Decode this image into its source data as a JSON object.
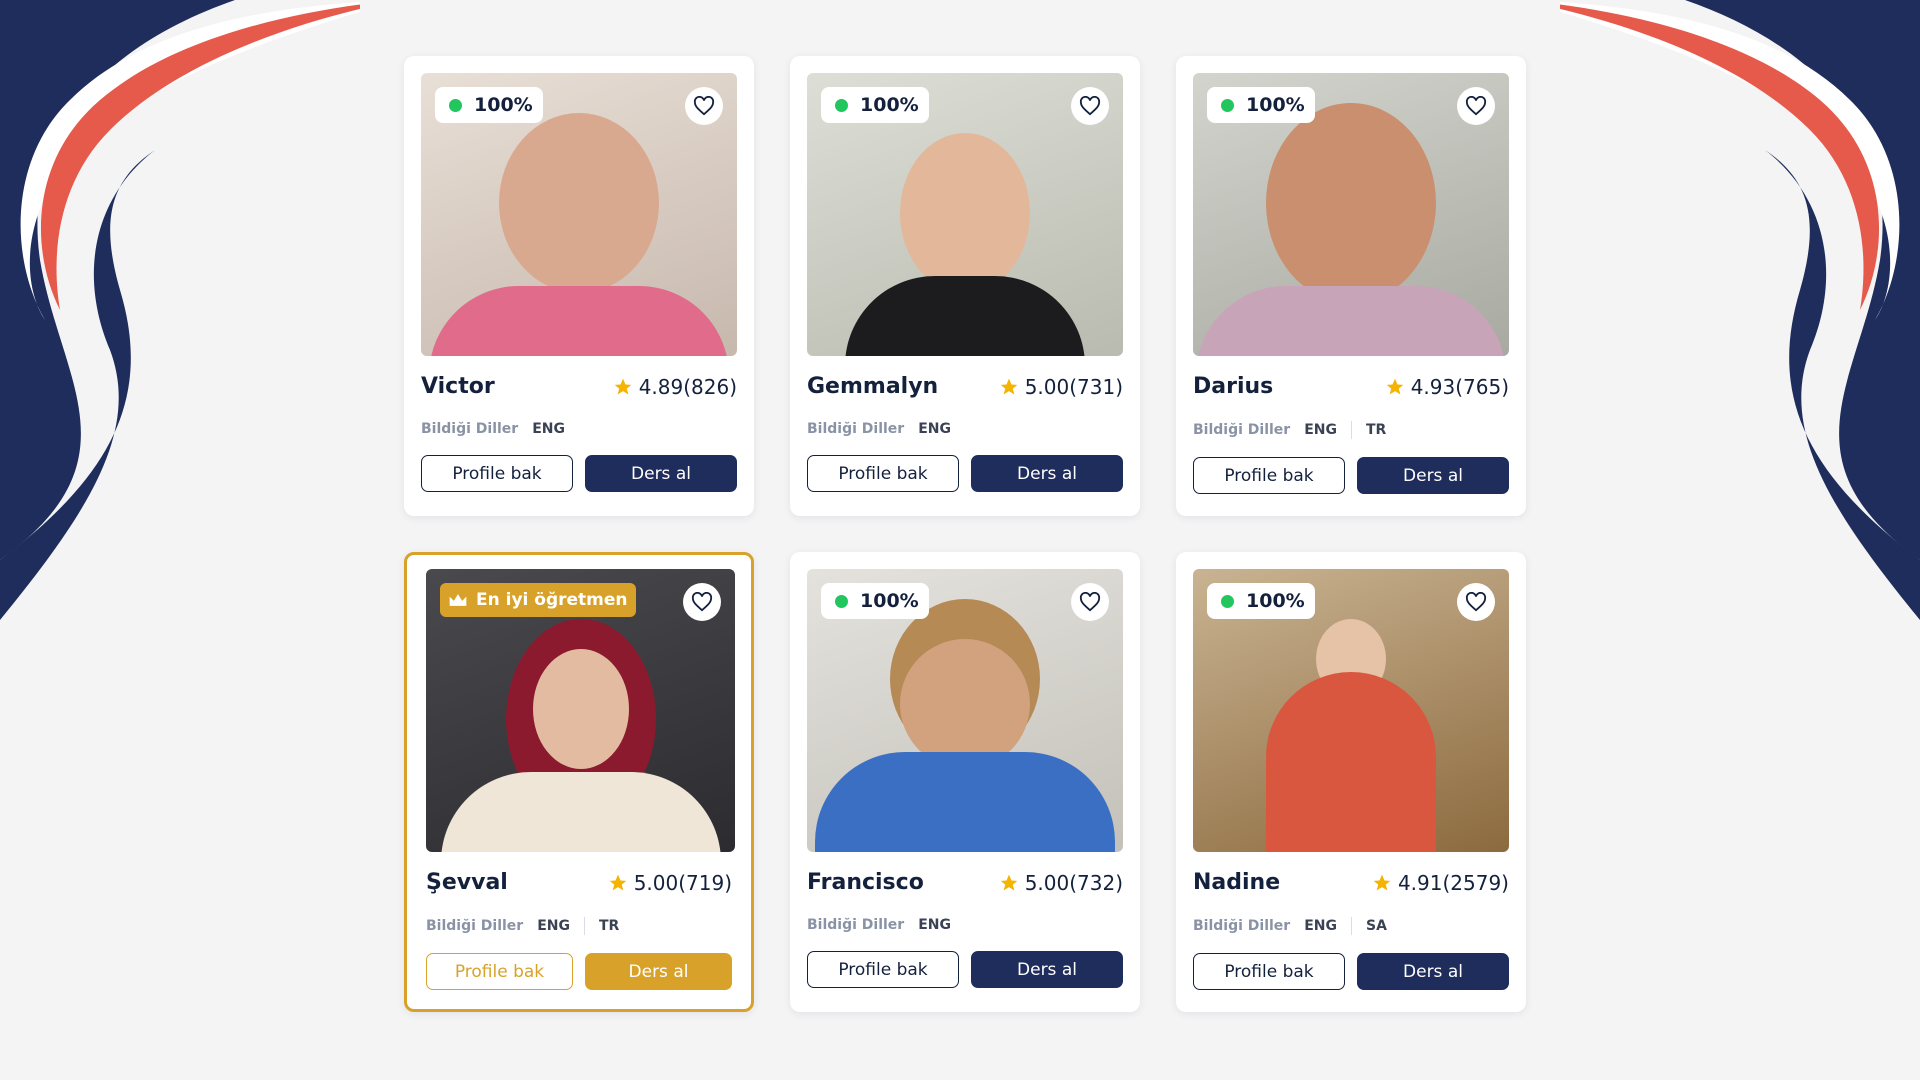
{
  "labels": {
    "languages_label": "Bildiği Diller",
    "profile_button": "Profile bak",
    "lesson_button": "Ders al",
    "best_teacher_badge": "En iyi öğretmen"
  },
  "colors": {
    "navy": "#1f2d5c",
    "coral": "#e65a4b",
    "gold": "#d8a22a",
    "online_green": "#22c55e",
    "star": "#f5b400"
  },
  "teachers": [
    {
      "name": "Victor",
      "rating": "4.89",
      "reviews": "(826)",
      "online": "100%",
      "languages": [
        "ENG"
      ],
      "featured": false,
      "icon": "favorite-heart-icon"
    },
    {
      "name": "Gemmalyn",
      "rating": "5.00",
      "reviews": "(731)",
      "online": "100%",
      "languages": [
        "ENG"
      ],
      "featured": false,
      "icon": "favorite-heart-icon"
    },
    {
      "name": "Darius",
      "rating": "4.93",
      "reviews": "(765)",
      "online": "100%",
      "languages": [
        "ENG",
        "TR"
      ],
      "featured": false,
      "icon": "favorite-heart-icon"
    },
    {
      "name": "Şevval",
      "rating": "5.00",
      "reviews": "(719)",
      "online": "",
      "languages": [
        "ENG",
        "TR"
      ],
      "featured": true,
      "icon": "favorite-heart-icon"
    },
    {
      "name": "Francisco",
      "rating": "5.00",
      "reviews": "(732)",
      "online": "100%",
      "languages": [
        "ENG"
      ],
      "featured": false,
      "icon": "favorite-heart-icon"
    },
    {
      "name": "Nadine",
      "rating": "4.91",
      "reviews": "(2579)",
      "online": "100%",
      "languages": [
        "ENG",
        "SA"
      ],
      "featured": false,
      "icon": "favorite-heart-icon"
    }
  ]
}
